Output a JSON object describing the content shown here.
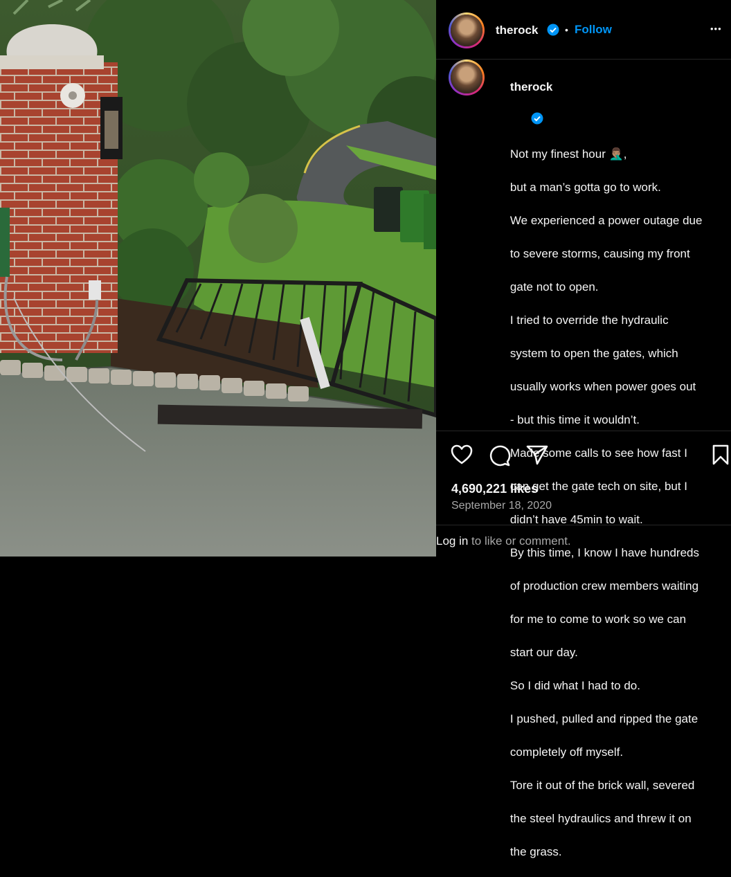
{
  "post": {
    "username": "therock",
    "follow_label": "Follow",
    "separator": "•",
    "more_label": "•••",
    "caption_lines": [
      "Not my finest hour 🤦🏽‍♂️,",
      "but a man’s gotta go to work.",
      "We experienced a power outage due",
      "to severe storms, causing my front",
      "gate not to open.",
      "I tried to override the hydraulic",
      "system to open the gates, which",
      "usually works when power goes out",
      "- but this time it wouldn’t.",
      "Made some calls to see how fast I",
      "can get the gate tech on site, but I",
      "didn’t have 45min to wait.",
      "By this time, I know I have hundreds",
      "of production crew members waiting",
      "for me to come to work so we can",
      "start our day.",
      "So I did what I had to do.",
      "I pushed, pulled and ripped the gate",
      "completely off myself.",
      "Tore it out of the brick wall, severed",
      "the steel hydraulics and threw it on",
      "the grass."
    ],
    "likes": "4,690,221 likes",
    "date": "September 18, 2020",
    "login_link": "Log in",
    "login_rest": " to like or comment."
  },
  "colors": {
    "accent": "#0095f6",
    "verified": "#0095f6",
    "secondary_text": "#a8a8a8",
    "background": "#000000"
  },
  "icons": [
    "verified-badge-icon",
    "more-options-icon",
    "heart-icon",
    "comment-icon",
    "share-icon",
    "bookmark-icon"
  ]
}
